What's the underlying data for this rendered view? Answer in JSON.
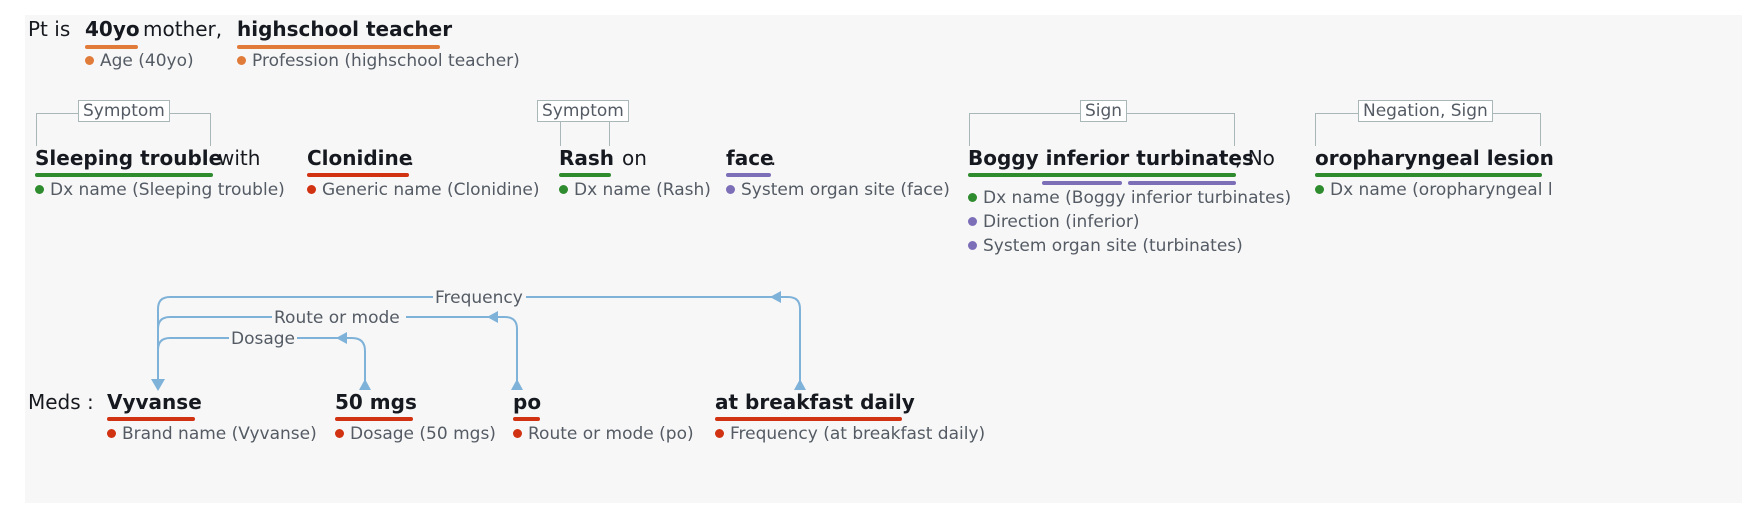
{
  "colors": {
    "orange": "#e07b39",
    "red": "#d13212",
    "green": "#2e8b2e",
    "purple": "#7d6eb8",
    "arrow": "#7fb2d8",
    "text": "#16191f",
    "label": "#545b64"
  },
  "line1": {
    "t0": "Pt is",
    "t1": "40yo",
    "t2": "mother,",
    "t3": "highschool teacher",
    "l1": "Age (40yo)",
    "l2": "Profession (highschool teacher)"
  },
  "line2": {
    "tag1": "Symptom",
    "tag2": "Symptom",
    "tag3": "Sign",
    "tag4": "Negation, Sign",
    "t1": "Sleeping trouble",
    "t2": "with",
    "t3": "Clonidine",
    "t4": ".",
    "t5": "Rash",
    "t6": "on",
    "t7": "face",
    "t8": ".",
    "t9": "Boggy inferior turbinates",
    "t10": ", No",
    "t11": "oropharyngeal lesion",
    "t12": ".",
    "l1": "Dx name (Sleeping trouble)",
    "l2": "Generic name (Clonidine)",
    "l3": "Dx name (Rash)",
    "l4": "System organ site (face)",
    "l5": "Dx name (Boggy inferior turbinates)",
    "l6": "Direction (inferior)",
    "l7": "System organ site (turbinates)",
    "l8": "Dx name (oropharyngeal l"
  },
  "relations": {
    "r1": "Frequency",
    "r2": "Route or mode",
    "r3": "Dosage"
  },
  "line3": {
    "t0": "Meds :",
    "t1": "Vyvanse",
    "t2": "50 mgs",
    "t3": "po",
    "t4": "at breakfast daily",
    "l1": "Brand name (Vyvanse)",
    "l2": "Dosage (50 mgs)",
    "l3": "Route or mode (po)",
    "l4": "Frequency (at breakfast daily)"
  }
}
